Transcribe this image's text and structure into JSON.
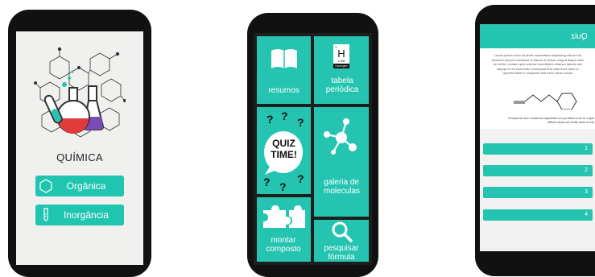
{
  "phone1": {
    "title": "QUÍMICA",
    "menu": [
      {
        "label": "Orgânica",
        "icon": "hexagon-icon"
      },
      {
        "label": "Inorgância",
        "icon": "test-tube-icon"
      }
    ],
    "logo": "chemistry-flasks-logo"
  },
  "phone2": {
    "tiles": [
      {
        "id": "resumos",
        "label": "resumos",
        "icon": "book-icon"
      },
      {
        "id": "tabela",
        "label": "tabela periódica",
        "icon": "element-card-icon"
      },
      {
        "id": "quiz",
        "label": "QUIZ TIME!",
        "icon": "quiz-bubble-icon"
      },
      {
        "id": "galeria",
        "label": "galeria de moleculas",
        "icon": "molecule-icon"
      },
      {
        "id": "montar",
        "label": "montar composto",
        "icon": "puzzle-icon"
      },
      {
        "id": "pesquisar",
        "label": "pesquisar fórmula",
        "icon": "magnifier-icon"
      }
    ],
    "element": {
      "symbol": "H",
      "number": "1",
      "mass": "1.008",
      "name": "Hydrogen"
    }
  },
  "phone3": {
    "header": "Quiz",
    "question_lines": [
      "Lorem ipsum dolor sit amet consectetur adipiscing elit sed do",
      "eiusmod tempor incididunt ut labore et dolore magna aliqua enim",
      "ad minim veniam quis nostrud exercitation ullamco laboris nisi",
      "aliquip ex ea commodo consequat duis aute irure dolor in",
      "reprehenderit in voluptate velit esse cillum dolore"
    ],
    "note_lines": [
      "Excepteur sint occaecat cupidatat non proident sunt in culpa",
      "officia deserunt mollit anim id est"
    ],
    "answers": [
      "1",
      "2",
      "3",
      "4"
    ],
    "structure_icon": "skeletal-formula-icon"
  },
  "colors": {
    "accent": "#25c4b1",
    "phone": "#111111",
    "screen1": "#f0f0ee"
  }
}
